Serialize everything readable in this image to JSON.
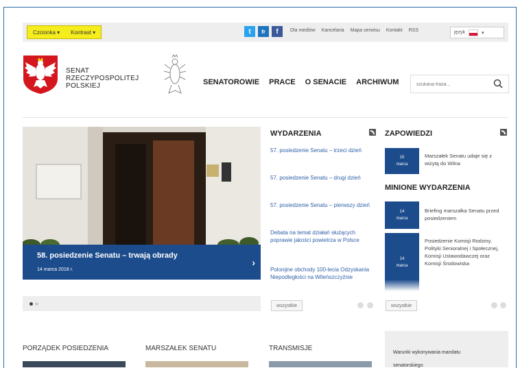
{
  "topbar": {
    "access": {
      "czcionka": "Czcionka",
      "kontrast": "Kontrast"
    },
    "links": [
      "Dla mediów",
      "Kancelaria",
      "Mapa serwisu",
      "Kontakt",
      "RSS"
    ],
    "lang_label": "język"
  },
  "header": {
    "brand": [
      "SENAT",
      "RZECZYPOSPOLITEJ",
      "POLSKIEJ"
    ],
    "nav": [
      "SENATOROWIE",
      "PRACE",
      "O SENACIE",
      "ARCHIWUM"
    ],
    "search_placeholder": "szukana fraza..."
  },
  "hero": {
    "title": "58. posiedzenie Senatu – trwają obrady",
    "date": "14 marca 2018 r."
  },
  "wydarzenia": {
    "heading": "WYDARZENIA",
    "items": [
      "57. posiedzenie Senatu – trzeci dzień",
      "57. posiedzenie Senatu – drugi dzień",
      "57. posiedzenie Senatu – pierwszy dzień",
      "Debata na temat działań służących poprawie jakości powietrza w Polsce",
      "Polonijne obchody 100-lecia Odzyskania Niepodległości na Wileńszczyźnie"
    ],
    "all_button": "wszystkie"
  },
  "zapowiedzi": {
    "heading": "ZAPOWIEDZI",
    "items": [
      {
        "day": "15",
        "month": "marca",
        "text": "Marszałek Senatu udaje się z wizytą do Wilna"
      }
    ]
  },
  "minione": {
    "heading": "MINIONE WYDARZENIA",
    "items": [
      {
        "day": "14",
        "month": "marca",
        "text": "Briefing marszałka Senatu przed posiedzeniem"
      },
      {
        "day": "14",
        "month": "marca",
        "text": "Posiedzenie Komisji Rodziny, Polityki Senioralnej i Społecznej, Komisji Ustawodawczej oraz Komisji Środowiska"
      }
    ],
    "all_button": "wszystkie"
  },
  "bottom": {
    "headings": [
      "PORZĄDEK POSIEDZENIA",
      "MARSZAŁEK SENATU",
      "TRANSMISJE"
    ],
    "side_links": [
      "Warunki wykonywania mandatu",
      "senatorskiego"
    ]
  },
  "colors": {
    "accent": "#1c4c8c",
    "link": "#2d5fa8",
    "highlight": "#f6ed1c"
  }
}
